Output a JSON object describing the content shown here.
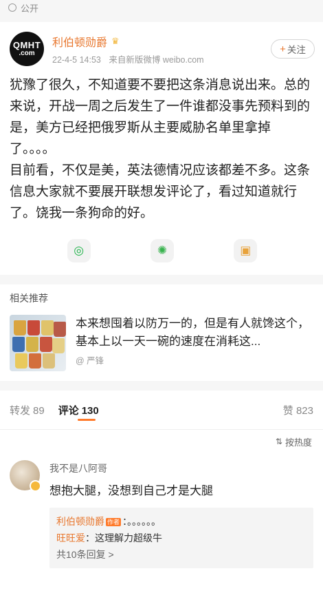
{
  "topbar": {
    "visibility": "公开"
  },
  "post": {
    "avatar_text_1": "QMHT",
    "avatar_text_2": ".com",
    "username": "利伯顿勋爵",
    "badge_icon": "crown-icon",
    "timestamp": "22-4-5 14:53",
    "source": "来自新版微博 weibo.com",
    "follow_label": "关注",
    "body": [
      "犹豫了很久，不知道要不要把这条消息说出来。总的来说，开战一周之后发生了一件谁都没事先预料到的是，美方已经把俄罗斯从主要威胁名单里拿掉了。。。。",
      "目前看，不仅是美，英法德情况应该都差不多。这条信息大家就不要展开联想发评论了，看过知道就行了。饶我一条狗命的好。"
    ],
    "share_icons": [
      "wechat-icon",
      "moments-icon",
      "image-share-icon"
    ]
  },
  "recommend": {
    "title": "相关推荐",
    "desc": "本来想囤着以防万一的，但是有人就馋这个，基本上以一天一碗的速度在消耗这...",
    "author": "@ 严锋"
  },
  "tabs": {
    "repost_label": "转发",
    "repost_count": "89",
    "comment_label": "评论",
    "comment_count": "130",
    "like_label": "赞",
    "like_count": "823"
  },
  "sort": {
    "label": "按热度"
  },
  "comment": {
    "name": "我不是八阿哥",
    "text": "想抱大腿，没想到自己才是大腿",
    "replies": [
      {
        "author": "利伯顿勋爵",
        "tag": "作者",
        "text": "：。。。。。。"
      },
      {
        "author": "旺旺爱",
        "tag": "",
        "text": "：这理解力超级牛"
      }
    ],
    "more": "共10条回复 >"
  },
  "colors": {
    "accent": "#e8772e",
    "tab_underline": "#ff7a2a"
  }
}
